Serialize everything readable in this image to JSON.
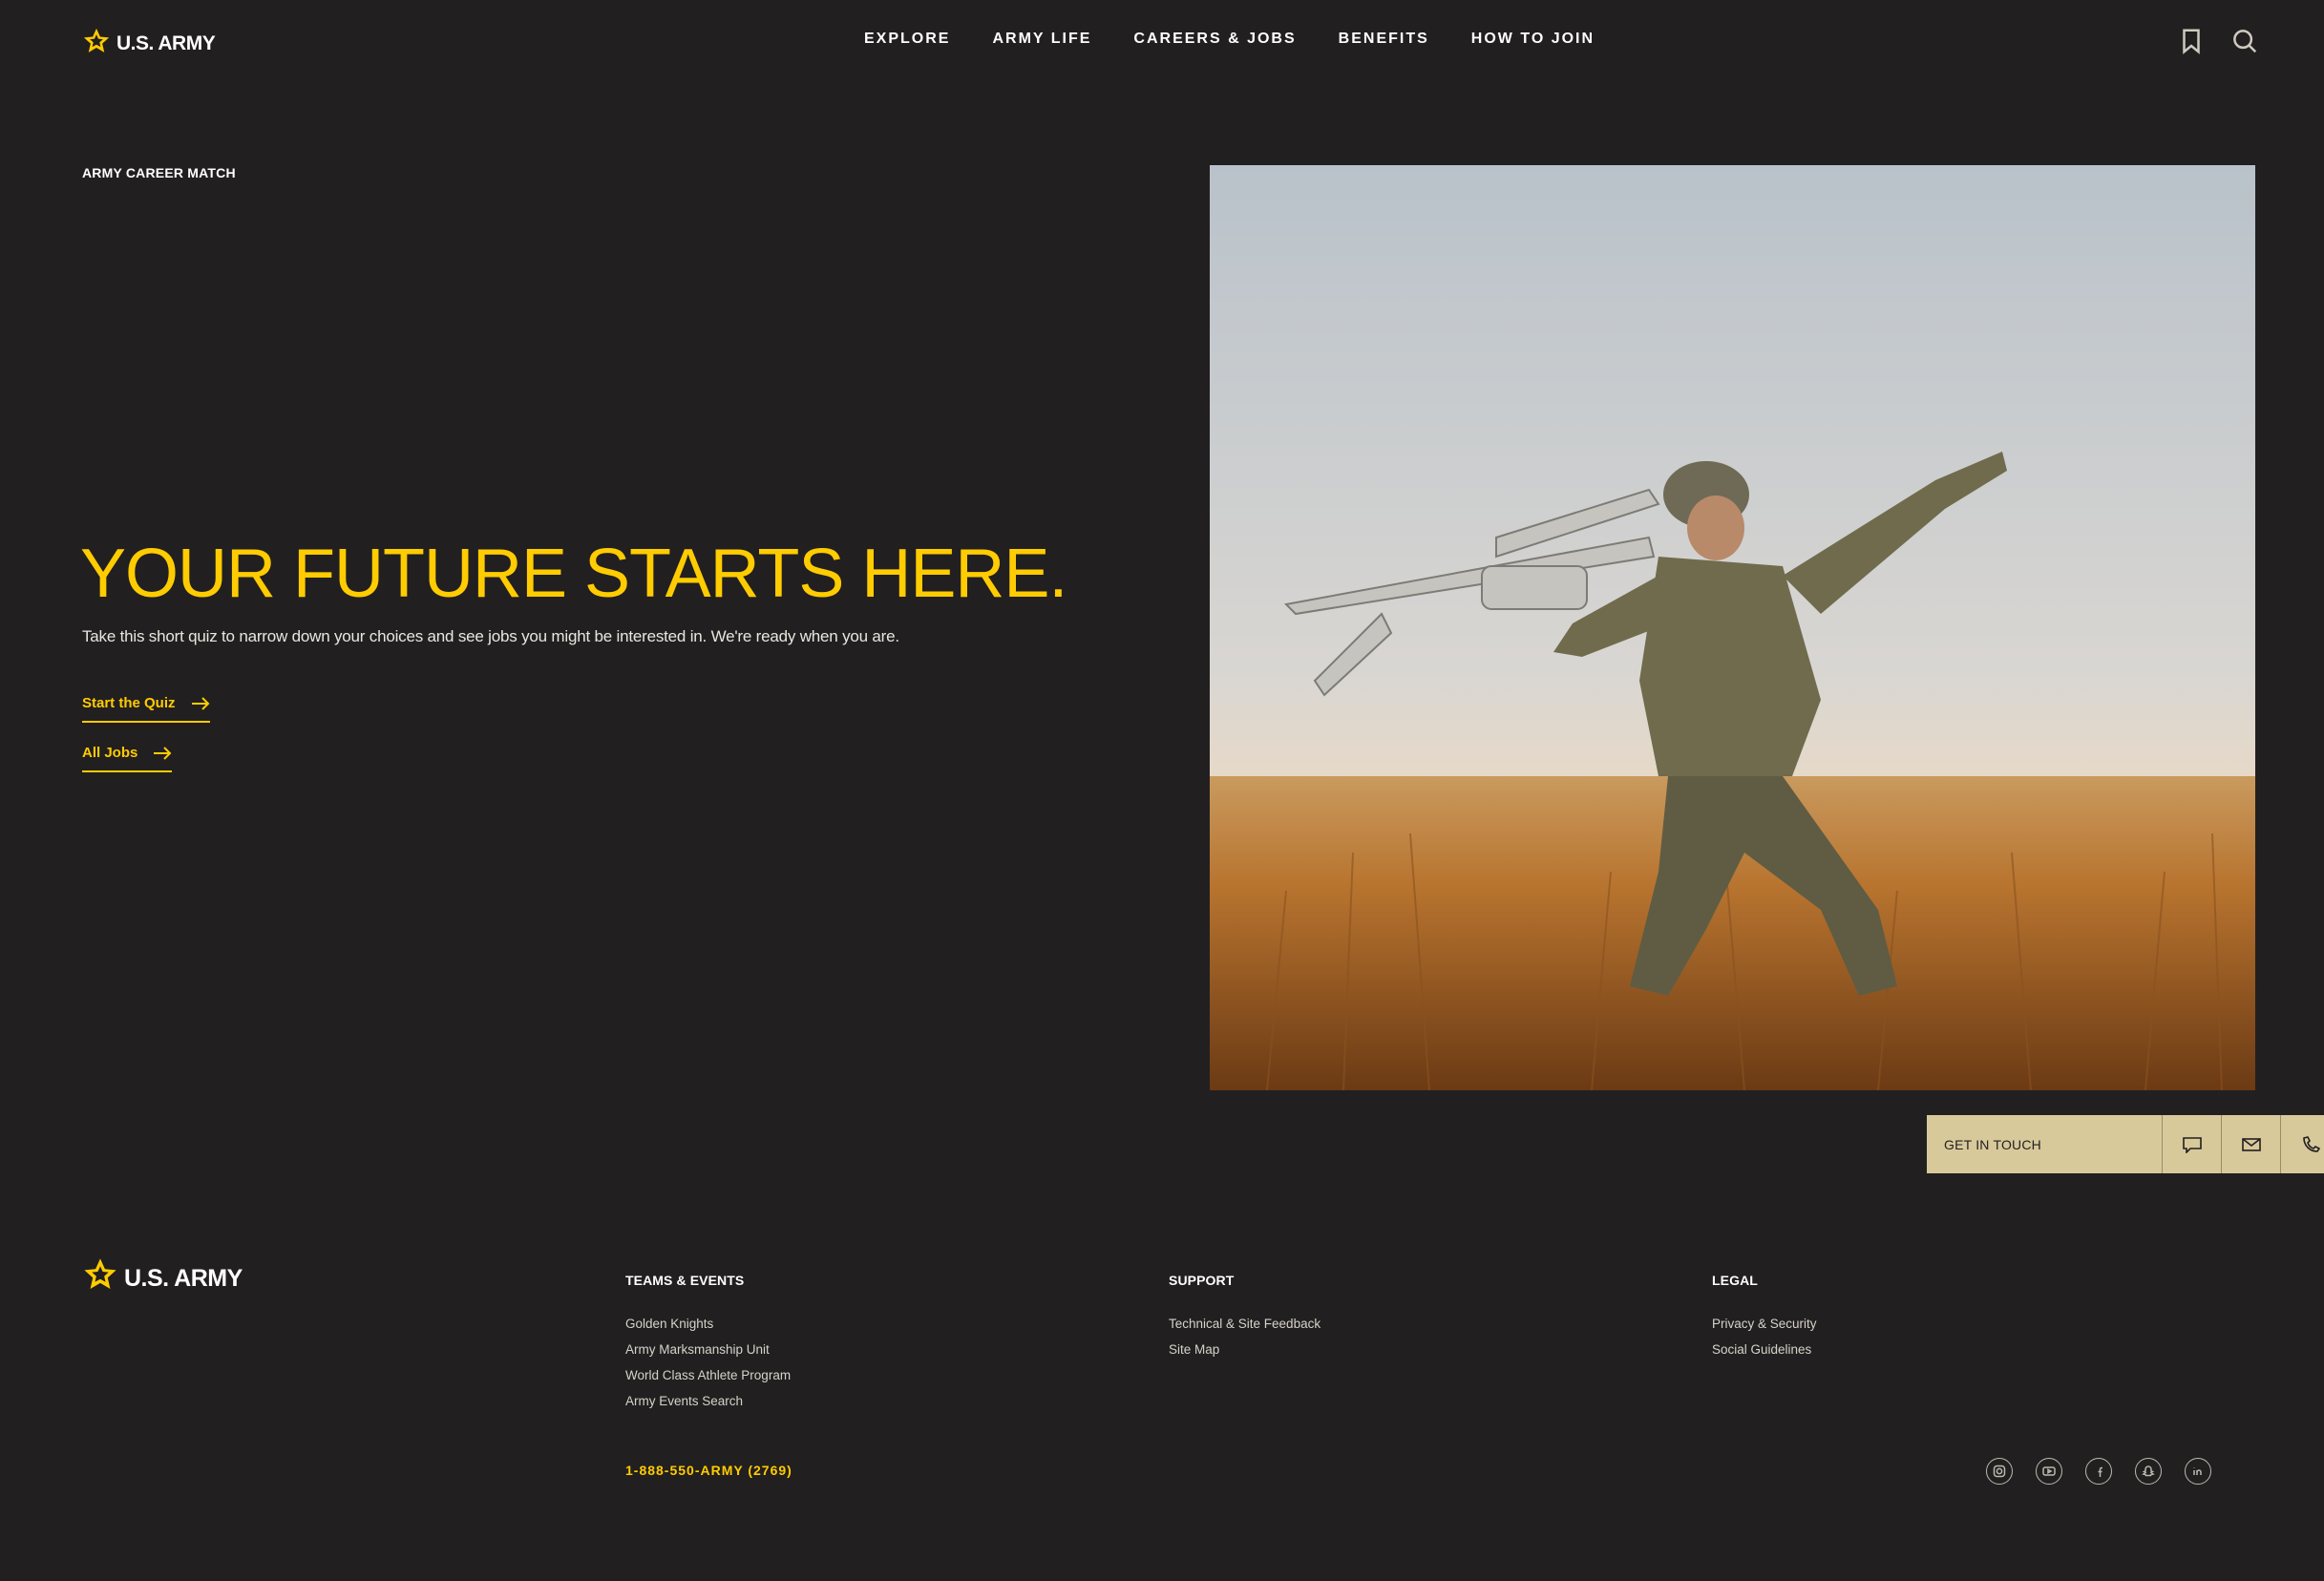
{
  "header": {
    "logo_text": "U.S. ARMY",
    "nav": [
      "EXPLORE",
      "ARMY LIFE",
      "CAREERS & JOBS",
      "BENEFITS",
      "HOW TO JOIN"
    ],
    "icons": [
      "bookmark-icon",
      "search-icon"
    ]
  },
  "hero": {
    "eyebrow": "ARMY CAREER MATCH",
    "headline": "YOUR FUTURE STARTS HERE.",
    "subcopy": "Take this short quiz to narrow down your choices and see jobs you might be interested in. We're ready when you are.",
    "cta_primary": "Start the Quiz",
    "cta_secondary": "All Jobs"
  },
  "contact": {
    "label": "GET IN TOUCH",
    "icons": [
      "chat-icon",
      "mail-icon",
      "phone-icon"
    ]
  },
  "footer": {
    "logo_text": "U.S. ARMY",
    "columns": [
      {
        "title": "TEAMS & EVENTS",
        "links": [
          "Golden Knights",
          "Army Marksmanship Unit",
          "World Class Athlete Program",
          "Army Events Search"
        ]
      },
      {
        "title": "SUPPORT",
        "links": [
          "Technical & Site Feedback",
          "Site Map"
        ]
      },
      {
        "title": "LEGAL",
        "links": [
          "Privacy & Security",
          "Social Guidelines"
        ]
      }
    ],
    "phone": "1-888-550-ARMY (2769)",
    "socials": [
      "instagram-icon",
      "youtube-icon",
      "facebook-icon",
      "snapchat-icon",
      "linkedin-icon"
    ]
  },
  "colors": {
    "background": "#221f20",
    "accent": "#ffcc01",
    "contact_bar": "#d8c99b"
  }
}
